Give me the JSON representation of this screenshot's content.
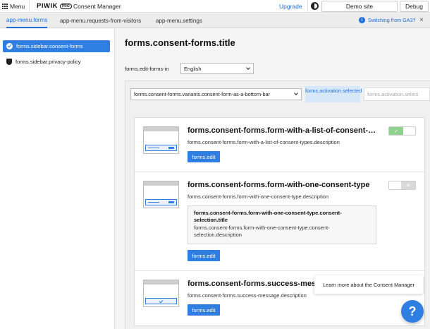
{
  "topbar": {
    "menu_label": "Menu",
    "logo_word": "PIWIK",
    "logo_badge": "PRO",
    "product_name": "Consent Manager",
    "upgrade_label": "Upgrade",
    "site_name": "Demo site",
    "debug_label": "Debug"
  },
  "tabs": [
    {
      "label": "app-menu.forms",
      "active": true
    },
    {
      "label": "app-menu.requests-from-visitors",
      "active": false
    },
    {
      "label": "app-menu.settings",
      "active": false
    }
  ],
  "ga3_banner": {
    "label": "Switching from GA3?",
    "close_icon": "close-icon"
  },
  "sidebar": {
    "items": [
      {
        "label": "forms.sidebar.consent-forms",
        "icon": "check-circle-icon",
        "active": true
      },
      {
        "label": "forms.sidebar.privacy-policy",
        "icon": "shield-icon",
        "active": false
      }
    ]
  },
  "main": {
    "title": "forms.consent-forms.title",
    "language_label": "forms.edit-forms-in",
    "language_value": "English",
    "variant_value": "forms.consent-forms.variants.consent-form-as-a-bottom-bar",
    "activation_selected": "forms.activation.selected",
    "activation_select": "forms.activation.select"
  },
  "cards": [
    {
      "title": "forms.consent-forms.form-with-a-list-of-consent-types",
      "description": "forms.consent-forms.form-with-a-list-of-consent-types.description",
      "edit_label": "forms.edit",
      "toggle_state": "on"
    },
    {
      "title": "forms.consent-forms.form-with-one-consent-type",
      "description": "forms.consent-forms.form-with-one-consent-type.description",
      "selection_title": "forms.consent-forms.form-with-one-consent-type.consent-selection.title",
      "selection_description": "forms.consent-forms.form-with-one-consent-type.consent-selection.description",
      "edit_label": "forms.edit",
      "toggle_state": "off"
    },
    {
      "title": "forms.consent-forms.success-message",
      "description": "forms.consent-forms.success-message.description",
      "edit_label": "forms.edit"
    }
  ],
  "help": {
    "tooltip": "Learn more about the Consent Manager",
    "button_glyph": "?"
  },
  "colors": {
    "accent": "#2f7fe3",
    "toggle_on": "#8fd18f"
  }
}
